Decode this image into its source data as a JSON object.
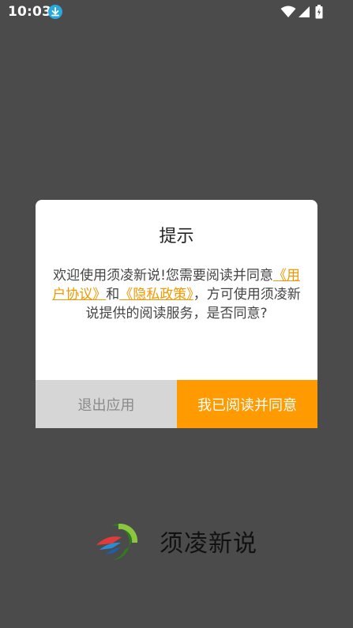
{
  "status_bar": {
    "time": "10:03",
    "icons": [
      "download-icon",
      "wifi-icon",
      "signal-icon",
      "battery-icon"
    ]
  },
  "dialog": {
    "title": "提示",
    "message_part1": "欢迎使用须凌新说!您需要阅读并同意",
    "link_user_agreement": "《用户协议》",
    "message_and": "和",
    "link_privacy_policy": "《隐私政策》",
    "message_part2": "，方可使用须凌新说提供的阅读服务，是否同意?",
    "exit_button": "退出应用",
    "agree_button": "我已阅读并同意"
  },
  "brand": {
    "name": "须凌新说"
  },
  "colors": {
    "overlay": "#4b4b4b",
    "accent": "#ff9a00",
    "link": "#f39800",
    "exit_button_bg": "#d6d6d6"
  }
}
